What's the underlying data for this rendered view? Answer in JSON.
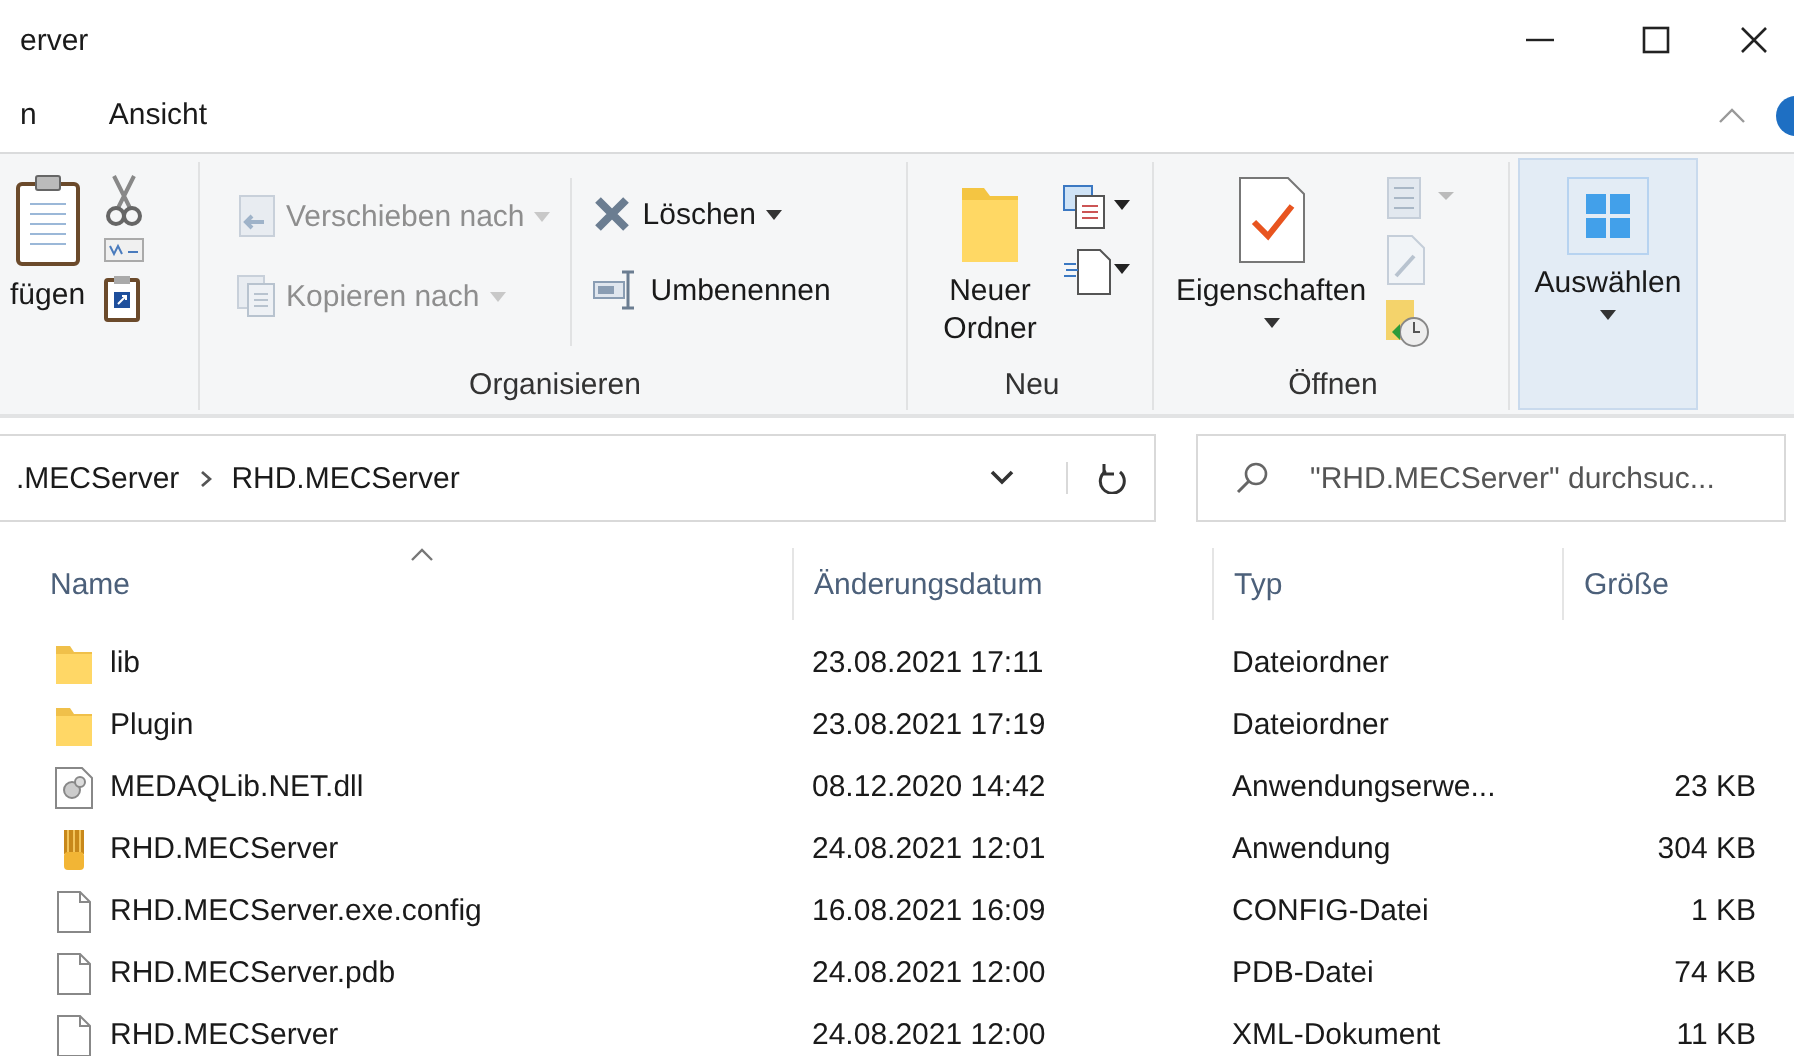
{
  "window": {
    "title": "erver"
  },
  "ribbon_tabs": [
    {
      "label": "n",
      "selected": false
    },
    {
      "label": "Ansicht",
      "selected": false
    }
  ],
  "ribbon": {
    "groups": [
      {
        "kind": "clipboard",
        "items": [
          {
            "label": "fügen"
          }
        ]
      },
      {
        "kind": "organize",
        "label": "Organisieren",
        "items": [
          {
            "label": "Verschieben nach",
            "disabled": true,
            "dropdown": true
          },
          {
            "label": "Kopieren nach",
            "disabled": true,
            "dropdown": true
          },
          {
            "label": "Löschen",
            "disabled": false,
            "dropdown": true
          },
          {
            "label": "Umbenennen",
            "disabled": false,
            "dropdown": false
          }
        ]
      },
      {
        "kind": "new",
        "label": "Neu",
        "items": [
          {
            "label": "Neuer Ordner"
          }
        ]
      },
      {
        "kind": "open",
        "label": "Öffnen",
        "items": [
          {
            "label": "Eigenschaften",
            "dropdown": true
          }
        ]
      },
      {
        "kind": "select",
        "items": [
          {
            "label": "Auswählen",
            "dropdown": true,
            "highlighted": true
          }
        ]
      }
    ]
  },
  "address": {
    "breadcrumbs": [
      ".MECServer",
      "RHD.MECServer"
    ],
    "search": {
      "placeholder": "\"RHD.MECServer\" durchsuc..."
    }
  },
  "file_list": {
    "columns": [
      {
        "label": "Name",
        "sorted": true
      },
      {
        "label": "Änderungsdatum",
        "sorted": false
      },
      {
        "label": "Typ",
        "sorted": false
      },
      {
        "label": "Größe",
        "sorted": false
      }
    ],
    "rows": [
      {
        "kind": "folder",
        "name": "lib",
        "date": "23.08.2021 17:11",
        "type": "Dateiordner"
      },
      {
        "kind": "folder",
        "name": "Plugin",
        "date": "23.08.2021 17:19",
        "type": "Dateiordner"
      },
      {
        "kind": "dll",
        "name": "MEDAQLib.NET.dll",
        "date": "08.12.2020 14:42",
        "type": "Anwendungserwe...",
        "size": "23 KB"
      },
      {
        "kind": "exe",
        "name": "RHD.MECServer",
        "date": "24.08.2021 12:01",
        "type": "Anwendung",
        "size": "304 KB"
      },
      {
        "kind": "file",
        "name": "RHD.MECServer.exe.config",
        "date": "16.08.2021 16:09",
        "type": "CONFIG-Datei",
        "size": "1 KB"
      },
      {
        "kind": "file",
        "name": "RHD.MECServer.pdb",
        "date": "24.08.2021 12:00",
        "type": "PDB-Datei",
        "size": "74 KB"
      },
      {
        "kind": "file",
        "name": "RHD.MECServer",
        "date": "24.08.2021 12:00",
        "type": "XML-Dokument",
        "size": "11 KB"
      }
    ]
  }
}
